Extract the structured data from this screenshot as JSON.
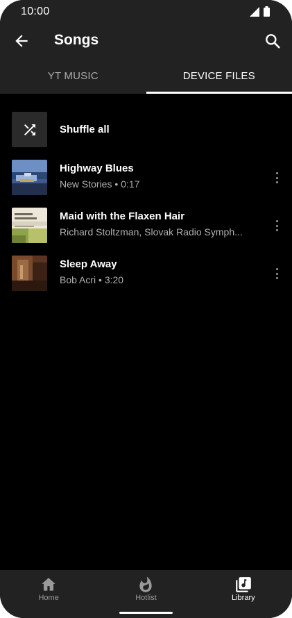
{
  "status_bar": {
    "time": "10:00",
    "icons": [
      "signal-icon",
      "battery-icon"
    ]
  },
  "app_bar": {
    "title": "Songs",
    "back_icon": "arrow-left-icon",
    "search_icon": "search-icon"
  },
  "tabs": [
    {
      "label": "YT MUSIC",
      "active": false
    },
    {
      "label": "DEVICE FILES",
      "active": true
    }
  ],
  "shuffle": {
    "label": "Shuffle all",
    "icon": "shuffle-icon"
  },
  "songs": [
    {
      "title": "Highway Blues",
      "subtitle": "New Stories • 0:17",
      "art": "blue-album-art"
    },
    {
      "title": "Maid with the Flaxen Hair",
      "subtitle": "Richard Stoltzman, Slovak Radio Symph...",
      "art": "green-album-art"
    },
    {
      "title": "Sleep Away",
      "subtitle": "Bob Acri • 3:20",
      "art": "brown-album-art"
    }
  ],
  "bottom_nav": [
    {
      "label": "Home",
      "icon": "home-icon",
      "active": false
    },
    {
      "label": "Hotlist",
      "icon": "flame-icon",
      "active": false
    },
    {
      "label": "Library",
      "icon": "library-icon",
      "active": true
    }
  ],
  "colors": {
    "background": "#000000",
    "surface": "#222222",
    "text_primary": "#ffffff",
    "text_secondary": "#b0b0b0"
  }
}
